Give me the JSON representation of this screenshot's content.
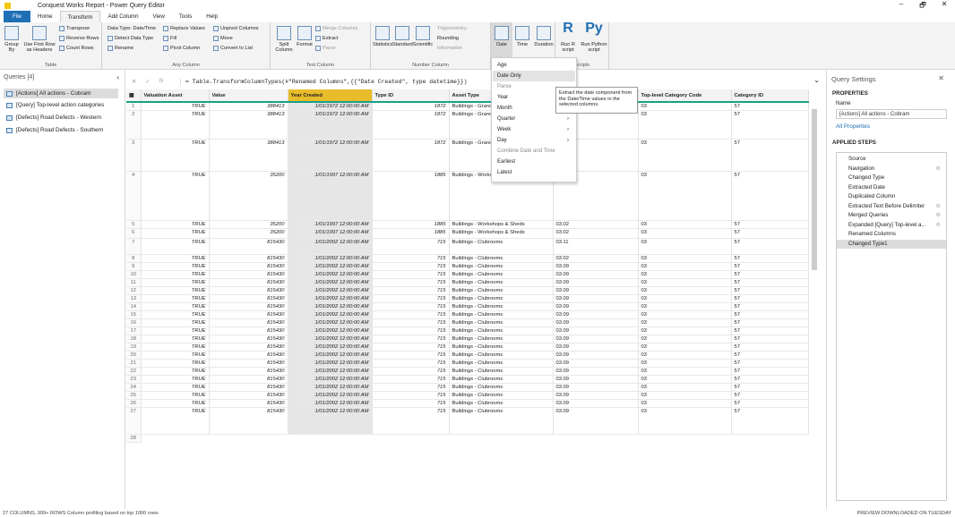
{
  "window": {
    "title": "Conquest Works Report - Power Query Editor",
    "minimize": "–",
    "restore": "🗗",
    "close": "✕"
  },
  "tabs": [
    "File",
    "Home",
    "Transform",
    "Add Column",
    "View",
    "Tools",
    "Help"
  ],
  "ribbon": {
    "table": {
      "label": "Table",
      "group_by": "Group By",
      "first_row": "Use First Row as Headers",
      "transpose": "Transpose",
      "reverse": "Reverse Rows",
      "count": "Count Rows"
    },
    "any": {
      "label": "Any Column",
      "data_type": "Data Type: Date/Time",
      "detect": "Detect Data Type",
      "rename": "Rename",
      "replace": "Replace Values",
      "fill": "Fill",
      "pivot": "Pivot Column",
      "unpivot": "Unpivot Columns",
      "move": "Move",
      "convert": "Convert to List"
    },
    "text": {
      "label": "Text Column",
      "split": "Split Column",
      "format": "Format",
      "merge": "Merge Columns",
      "extract": "Extract",
      "parse": "Parse"
    },
    "number": {
      "label": "Number Column",
      "stats": "Statistics",
      "standard": "Standard",
      "scientific": "Scientific",
      "trig": "Trigonometry",
      "rounding": "Rounding",
      "info": "Information"
    },
    "date": {
      "date": "Date",
      "time": "Time",
      "duration": "Duration"
    },
    "scripts": {
      "label": "Scripts",
      "r": "Run R script",
      "py": "Run Python script"
    }
  },
  "queries": {
    "title": "Queries [4]",
    "items": [
      "[Actions] All actions - Cobram",
      "[Query] Top-level action categories",
      "[Defects] Road Defects - Western",
      "[Defects] Road Defects - Southern"
    ]
  },
  "formula": "= Table.TransformColumnTypes(#\"Renamed Columns\",{{\"Date Created\", type datetime}})",
  "columns": [
    "Valuation Asset",
    "Value",
    "Year Created",
    "Type ID",
    "Asset Type",
    "",
    "Top-level Category Code",
    "Category ID"
  ],
  "rows": [
    [
      "1",
      "TRUE",
      "388413",
      "1/01/1972 12:00:00 AM",
      "1872",
      "Buildings - Grandstands",
      "",
      "03",
      "57"
    ],
    [
      "2",
      "TRUE",
      "388413",
      "1/01/1972 12:00:00 AM",
      "1872",
      "Buildings - Grandstands",
      "",
      "03",
      "57"
    ],
    [
      "3",
      "TRUE",
      "388413",
      "1/01/1972 12:00:00 AM",
      "1872",
      "Buildings - Grandstands",
      "",
      "03",
      "57"
    ],
    [
      "4",
      "TRUE",
      "35200",
      "1/01/1997 12:00:00 AM",
      "1885",
      "Buildings - Workshops & Sheds",
      "",
      "03",
      "57"
    ],
    [
      "5",
      "TRUE",
      "35200",
      "1/01/1997 12:00:00 AM",
      "1885",
      "Buildings - Workshops & Sheds",
      "03.02",
      "03",
      "57"
    ],
    [
      "6",
      "TRUE",
      "35200",
      "1/01/1997 12:00:00 AM",
      "1885",
      "Buildings - Workshops & Sheds",
      "03.02",
      "03",
      "57"
    ],
    [
      "7",
      "TRUE",
      "815430",
      "1/01/2002 12:00:00 AM",
      "715",
      "Buildings - Clubrooms",
      "03.11",
      "03",
      "57"
    ],
    [
      "8",
      "TRUE",
      "815430",
      "1/01/2002 12:00:00 AM",
      "715",
      "Buildings - Clubrooms",
      "03.02",
      "03",
      "57"
    ],
    [
      "9",
      "TRUE",
      "815430",
      "1/01/2002 12:00:00 AM",
      "715",
      "Buildings - Clubrooms",
      "03.09",
      "03",
      "57"
    ],
    [
      "10",
      "TRUE",
      "815430",
      "1/01/2002 12:00:00 AM",
      "715",
      "Buildings - Clubrooms",
      "03.09",
      "03",
      "57"
    ],
    [
      "11",
      "TRUE",
      "815430",
      "1/01/2002 12:00:00 AM",
      "715",
      "Buildings - Clubrooms",
      "03.09",
      "03",
      "57"
    ],
    [
      "12",
      "TRUE",
      "815430",
      "1/01/2002 12:00:00 AM",
      "715",
      "Buildings - Clubrooms",
      "03.09",
      "03",
      "57"
    ],
    [
      "13",
      "TRUE",
      "815430",
      "1/01/2002 12:00:00 AM",
      "715",
      "Buildings - Clubrooms",
      "03.09",
      "03",
      "57"
    ],
    [
      "14",
      "TRUE",
      "815430",
      "1/01/2002 12:00:00 AM",
      "715",
      "Buildings - Clubrooms",
      "03.09",
      "03",
      "57"
    ],
    [
      "15",
      "TRUE",
      "815430",
      "1/01/2002 12:00:00 AM",
      "715",
      "Buildings - Clubrooms",
      "03.09",
      "03",
      "57"
    ],
    [
      "16",
      "TRUE",
      "815430",
      "1/01/2002 12:00:00 AM",
      "715",
      "Buildings - Clubrooms",
      "03.09",
      "03",
      "57"
    ],
    [
      "17",
      "TRUE",
      "815430",
      "1/01/2002 12:00:00 AM",
      "715",
      "Buildings - Clubrooms",
      "03.09",
      "03",
      "57"
    ],
    [
      "18",
      "TRUE",
      "815430",
      "1/01/2002 12:00:00 AM",
      "715",
      "Buildings - Clubrooms",
      "03.09",
      "03",
      "57"
    ],
    [
      "19",
      "TRUE",
      "815430",
      "1/01/2002 12:00:00 AM",
      "715",
      "Buildings - Clubrooms",
      "03.09",
      "03",
      "57"
    ],
    [
      "20",
      "TRUE",
      "815430",
      "1/01/2002 12:00:00 AM",
      "715",
      "Buildings - Clubrooms",
      "03.09",
      "03",
      "57"
    ],
    [
      "21",
      "TRUE",
      "815430",
      "1/01/2002 12:00:00 AM",
      "715",
      "Buildings - Clubrooms",
      "03.09",
      "03",
      "57"
    ],
    [
      "22",
      "TRUE",
      "815430",
      "1/01/2002 12:00:00 AM",
      "715",
      "Buildings - Clubrooms",
      "03.09",
      "03",
      "57"
    ],
    [
      "23",
      "TRUE",
      "815430",
      "1/01/2002 12:00:00 AM",
      "715",
      "Buildings - Clubrooms",
      "03.09",
      "03",
      "57"
    ],
    [
      "24",
      "TRUE",
      "815430",
      "1/01/2002 12:00:00 AM",
      "715",
      "Buildings - Clubrooms",
      "03.09",
      "03",
      "57"
    ],
    [
      "25",
      "TRUE",
      "815430",
      "1/01/2002 12:00:00 AM",
      "715",
      "Buildings - Clubrooms",
      "03.09",
      "03",
      "57"
    ],
    [
      "26",
      "TRUE",
      "815430",
      "1/01/2002 12:00:00 AM",
      "715",
      "Buildings - Clubrooms",
      "03.09",
      "03",
      "57"
    ],
    [
      "27",
      "TRUE",
      "815430",
      "1/01/2002 12:00:00 AM",
      "715",
      "Buildings - Clubrooms",
      "03.09",
      "03",
      "57"
    ]
  ],
  "row_tail": "28",
  "menu": {
    "items": [
      "Age",
      "Date Only",
      "Parse",
      "Year",
      "Month",
      "Quarter",
      "Week",
      "Day",
      "Combine Date and Time",
      "Earliest",
      "Latest"
    ],
    "tooltip": "Extract the date component from the Date/Time values in the selected columns."
  },
  "settings": {
    "title": "Query Settings",
    "properties": "PROPERTIES",
    "name_label": "Name",
    "name_value": "[Actions] All actions - Cobram",
    "all_props": "All Properties",
    "applied": "APPLIED STEPS",
    "steps": [
      "Source",
      "Navigation",
      "Changed Type",
      "Extracted Date",
      "Duplicated Column",
      "Extracted Text Before Delimiter",
      "Merged Queries",
      "Expanded [Query] Top-level a...",
      "Renamed Columns",
      "Changed Type1"
    ]
  },
  "status": {
    "left": "27 COLUMNS, 999+ ROWS   Column profiling based on top 1000 rows",
    "right": "PREVIEW DOWNLOADED ON TUESDAY"
  },
  "colors": {
    "accent": "#18a08a",
    "selected_header": "#e8bc2a",
    "file_tab": "#1f6fb5"
  }
}
